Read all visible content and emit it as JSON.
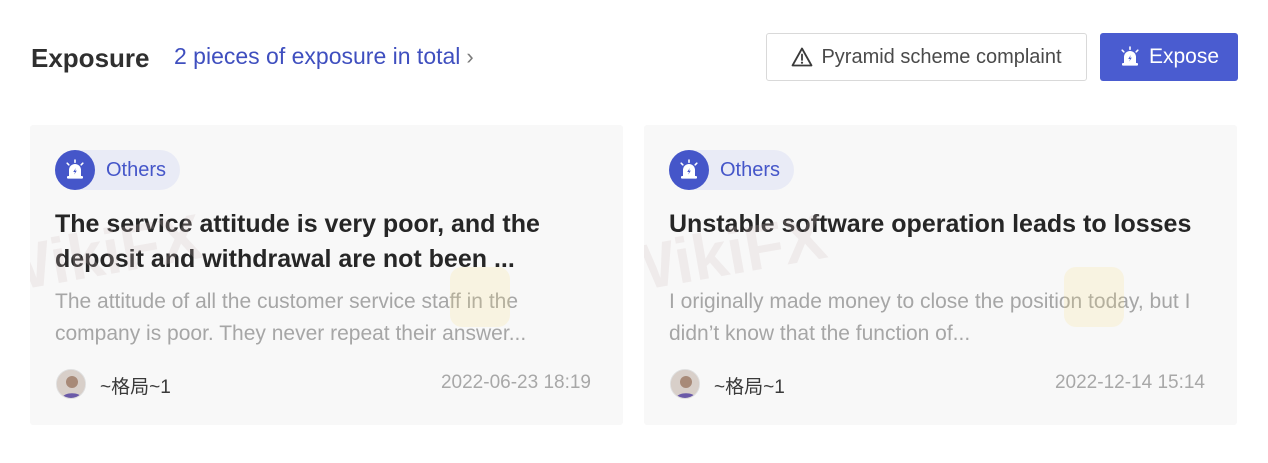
{
  "header": {
    "title": "Exposure",
    "total_link": "2 pieces of exposure in total",
    "chevron_glyph": "›",
    "complaint_button": "Pyramid scheme complaint",
    "expose_button": "Expose"
  },
  "watermark_text": "WikiFX",
  "colors": {
    "accent": "#4a5cd0",
    "link": "#3f4fbf",
    "card_bg": "#f8f8f8",
    "tag_bg": "#e9ebf6"
  },
  "cards": [
    {
      "tag": "Others",
      "tag_icon": "siren-icon",
      "title": "The service attitude is very poor, and the deposit and withdrawal are not been ...",
      "description": "The attitude of all the customer service staff in the company is poor. They never repeat their answer...",
      "user": "~格局~1",
      "timestamp": "2022-06-23 18:19"
    },
    {
      "tag": "Others",
      "tag_icon": "siren-icon",
      "title": "Unstable software operation leads to losses",
      "description": "I originally made money to close the position today, but I didn’t know that the function of...",
      "user": "~格局~1",
      "timestamp": "2022-12-14 15:14"
    }
  ]
}
